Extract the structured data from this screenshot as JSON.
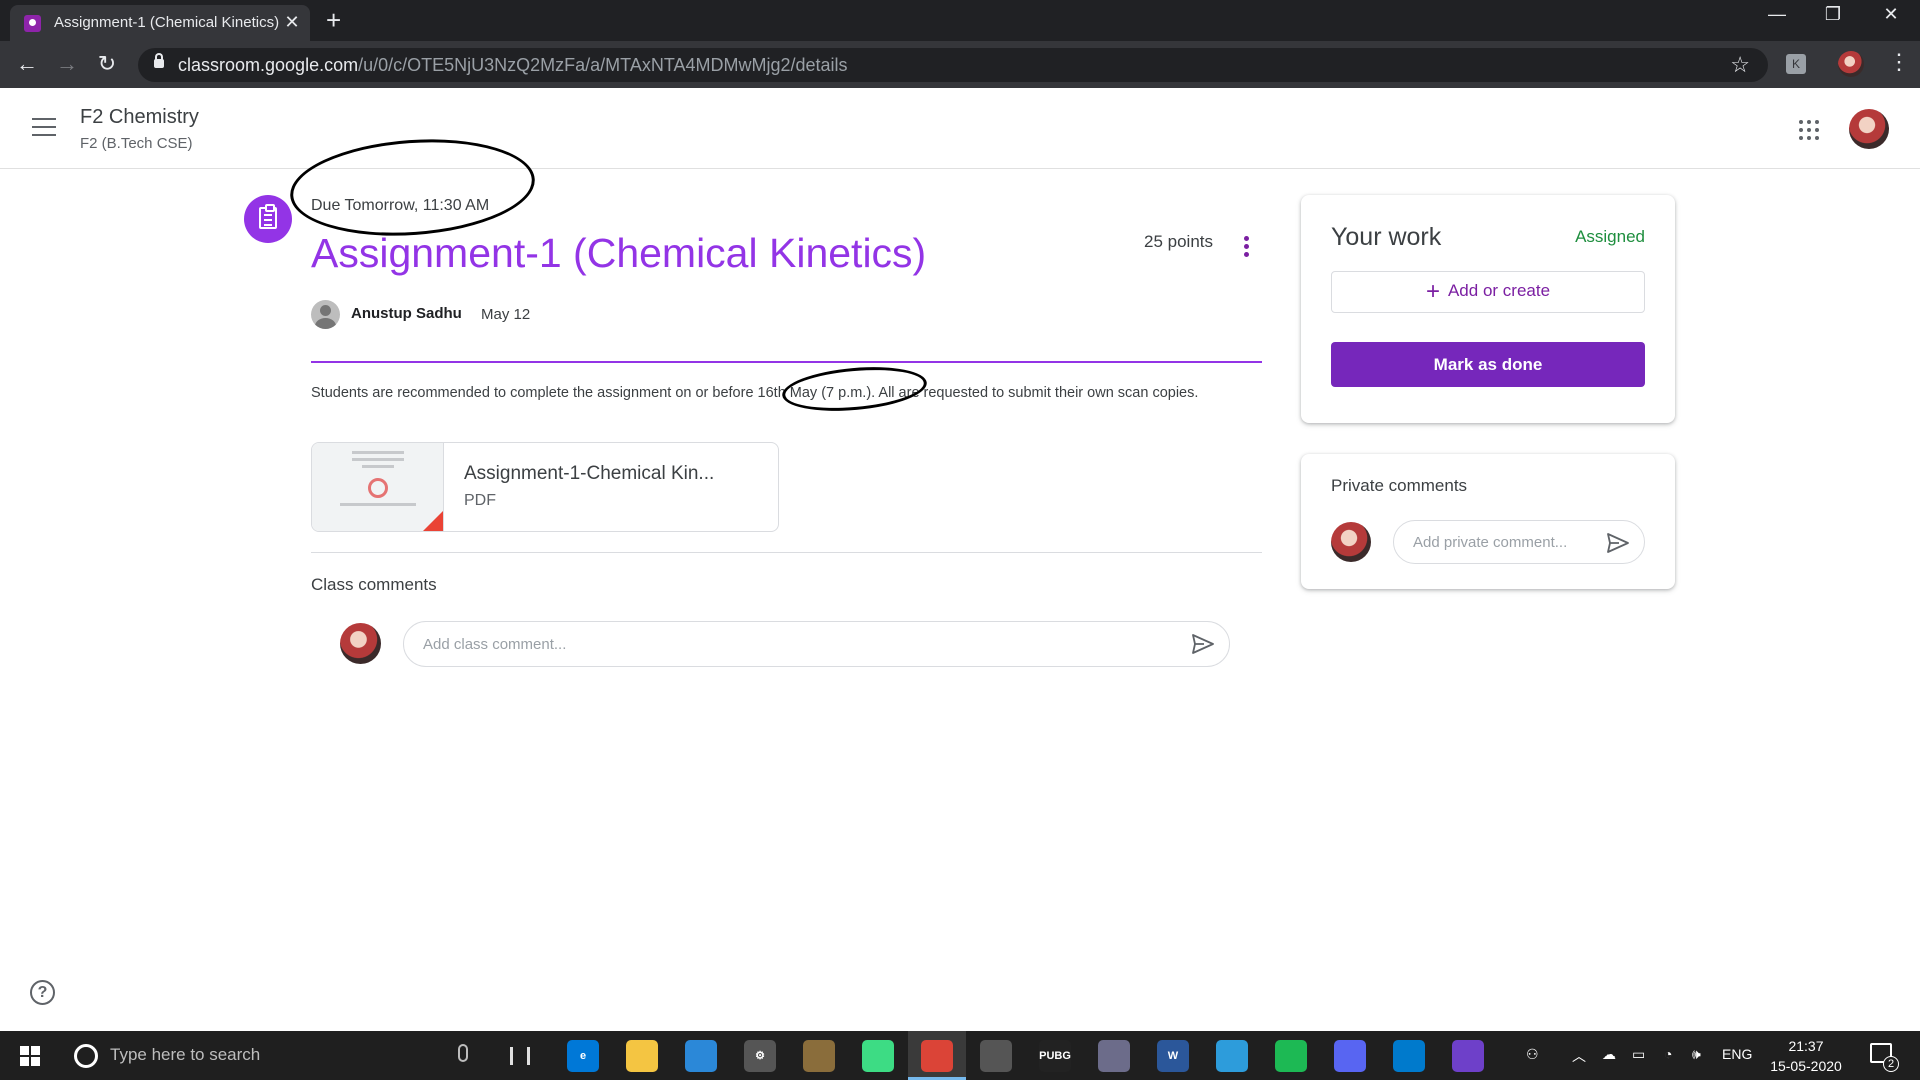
{
  "browser": {
    "tab_title": "Assignment-1 (Chemical Kinetics)",
    "url_host": "classroom.google.com",
    "url_path": "/u/0/c/OTE5NjU3NzQ2MzFa/a/MTAxNTA4MDMwMjg2/details",
    "extension_letter": "K"
  },
  "header": {
    "class_name": "F2 Chemistry",
    "section": "F2 (B.Tech CSE)"
  },
  "assignment": {
    "due": "Due Tomorrow, 11:30 AM",
    "title": "Assignment-1 (Chemical Kinetics)",
    "points": "25 points",
    "author": "Anustup Sadhu",
    "posted_date": "May 12",
    "instructions": "Students are recommended to complete the assignment on or before 16th May (7 p.m.). All are requested to submit their own scan copies.",
    "attachment": {
      "name": "Assignment-1-Chemical Kin...",
      "type": "PDF"
    }
  },
  "comments": {
    "heading": "Class comments",
    "placeholder": "Add class comment..."
  },
  "your_work": {
    "title": "Your work",
    "status": "Assigned",
    "add_create_label": "Add or create",
    "mark_done_label": "Mark as done"
  },
  "private_comments": {
    "title": "Private comments",
    "placeholder": "Add private comment..."
  },
  "taskbar": {
    "search_placeholder": "Type here to search",
    "language": "ENG",
    "time": "21:37",
    "date": "15-05-2020",
    "notification_count": "2",
    "apps": [
      {
        "name": "edge-icon",
        "color": "#0078d7",
        "label": "e"
      },
      {
        "name": "file-explorer-icon",
        "color": "#f4c542",
        "label": ""
      },
      {
        "name": "store-icon",
        "color": "#2b88d8",
        "label": ""
      },
      {
        "name": "settings-icon",
        "color": "#555555",
        "label": "⚙"
      },
      {
        "name": "paint-icon",
        "color": "#8a6d3b",
        "label": ""
      },
      {
        "name": "android-studio-icon",
        "color": "#3ddc84",
        "label": ""
      },
      {
        "name": "chrome-icon",
        "color": "#db4437",
        "label": ""
      },
      {
        "name": "game-icon",
        "color": "#555555",
        "label": ""
      },
      {
        "name": "pubg-icon",
        "color": "#222222",
        "label": "PUBG"
      },
      {
        "name": "media-icon",
        "color": "#6c6c8a",
        "label": ""
      },
      {
        "name": "word-icon",
        "color": "#2b579a",
        "label": "W"
      },
      {
        "name": "app-blue-icon",
        "color": "#2d9cdb",
        "label": ""
      },
      {
        "name": "spotify-icon",
        "color": "#1db954",
        "label": ""
      },
      {
        "name": "discord-icon",
        "color": "#5865f2",
        "label": ""
      },
      {
        "name": "vscode-icon",
        "color": "#007acc",
        "label": ""
      },
      {
        "name": "github-icon",
        "color": "#6e40c9",
        "label": ""
      }
    ]
  },
  "colors": {
    "accent_purple": "#9334e6",
    "button_purple": "#7627bb",
    "assigned_green": "#1e8e3e"
  }
}
